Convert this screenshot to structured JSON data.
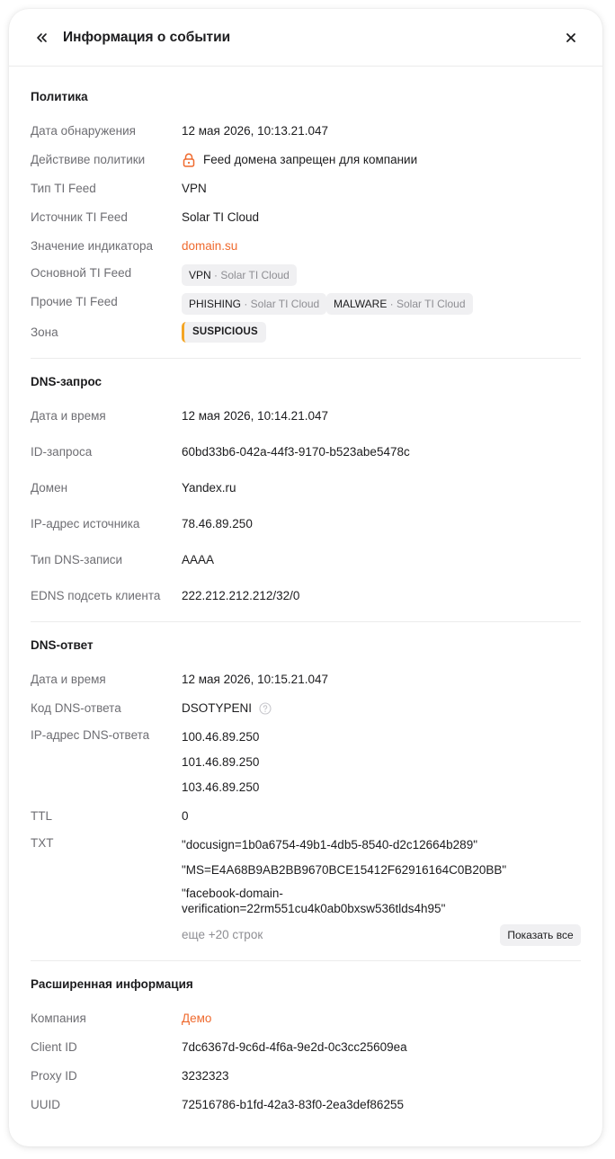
{
  "header": {
    "title": "Информация о событии"
  },
  "policy": {
    "title": "Политика",
    "rows": [
      {
        "label": "Дата обнаружения",
        "value": "12 мая 2026, 10:13.21.047"
      },
      {
        "label": "Действиве политики",
        "value": "Feed домена запрещен для компании"
      },
      {
        "label": "Тип TI Feed",
        "value": "VPN"
      },
      {
        "label": "Источник TI Feed",
        "value": "Solar TI Cloud"
      },
      {
        "label": "Значение индикатора",
        "value": "domain.su"
      },
      {
        "label": "Основной TI Feed"
      },
      {
        "label": "Прочие TI Feed"
      },
      {
        "label": "Зона",
        "value": "SUSPICIOUS"
      }
    ],
    "main_feed": {
      "name": "VPN",
      "source": " · Solar TI Cloud"
    },
    "other_feeds": [
      {
        "name": "PHISHING",
        "source": " · Solar TI Cloud"
      },
      {
        "name": "MALWARE",
        "source": " · Solar TI Cloud"
      }
    ]
  },
  "dns_request": {
    "title": "DNS-запрос",
    "rows": [
      {
        "label": "Дата и время",
        "value": "12 мая 2026, 10:14.21.047"
      },
      {
        "label": "ID-запроса",
        "value": "60bd33b6-042a-44f3-9170-b523abe5478c"
      },
      {
        "label": "Домен",
        "value": "Yandex.ru"
      },
      {
        "label": "IP-адрес источника",
        "value": "78.46.89.250"
      },
      {
        "label": "Тип DNS-записи",
        "value": "AAAA"
      },
      {
        "label": "EDNS подсеть клиента",
        "value": "222.212.212.212/32/0"
      }
    ]
  },
  "dns_response": {
    "title": "DNS-ответ",
    "rows": [
      {
        "label": "Дата и время",
        "value": "12 мая 2026, 10:15.21.047"
      },
      {
        "label": "Код DNS-ответа",
        "value": "DSOTYPENI"
      },
      {
        "label": "IP-адрес DNS-ответа"
      },
      {
        "label": "TTL",
        "value": "0"
      },
      {
        "label": "TXT"
      }
    ],
    "ips": [
      "100.46.89.250",
      "101.46.89.250",
      "103.46.89.250"
    ],
    "txt": [
      "\"docusign=1b0a6754-49b1-4db5-8540-d2c12664b289\"",
      "\"MS=E4A68B9AB2BB9670BCE15412F62916164C0B20BB\"",
      "\"facebook-domain-",
      "verification=22rm551cu4k0ab0bxsw536tlds4h95\""
    ],
    "more_text": "еще +20 строк",
    "show_all_label": "Показать все"
  },
  "extended": {
    "title": "Расширенная информация",
    "rows": [
      {
        "label": "Компания",
        "value": "Демо"
      },
      {
        "label": "Client ID",
        "value": "7dc6367d-9c6d-4f6a-9e2d-0c3cc25609ea"
      },
      {
        "label": "Proxy ID",
        "value": "3232323"
      },
      {
        "label": "UUID",
        "value": "72516786-b1fd-42a3-83f0-2ea3def86255"
      }
    ]
  },
  "colors": {
    "accent": "#ef6a2e",
    "zone_suspicious": "#f4a524"
  },
  "icons": [
    "double-chevron-left-icon",
    "close-icon",
    "lock-icon",
    "help-icon"
  ]
}
